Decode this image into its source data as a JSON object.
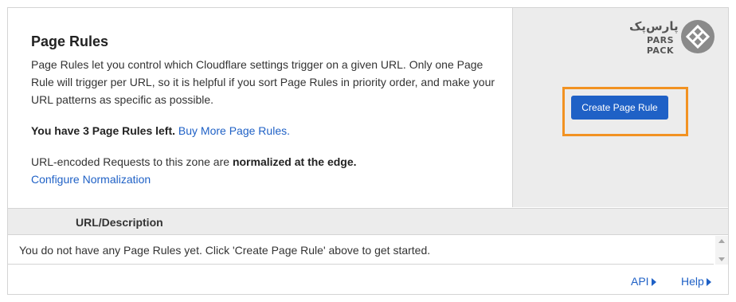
{
  "page": {
    "title": "Page Rules",
    "description": "Page Rules let you control which Cloudflare settings trigger on a given URL. Only one Page Rule will trigger per URL, so it is helpful if you sort Page Rules in priority order, and make your URL patterns as specific as possible.",
    "remaining_text": "You have 3 Page Rules left.",
    "buy_more_link": "Buy More Page Rules.",
    "normalization_prefix": "URL-encoded Requests to this zone are ",
    "normalization_bold": "normalized at the edge.",
    "configure_link": "Configure Normalization"
  },
  "actions": {
    "create_button": "Create Page Rule",
    "highlight_color": "#f29222",
    "button_color": "#1f61c6"
  },
  "logo": {
    "text_fa": "پارس‌پک",
    "text_en": "PARS PACK"
  },
  "table": {
    "column_header": "URL/Description",
    "empty_message": "You do not have any Page Rules yet. Click 'Create Page Rule' above to get started."
  },
  "footer": {
    "api_label": "API",
    "help_label": "Help"
  }
}
